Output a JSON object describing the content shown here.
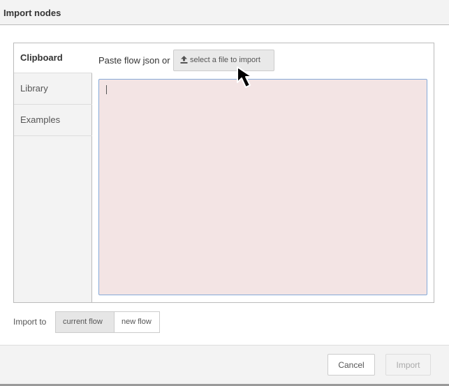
{
  "dialog": {
    "title": "Import nodes"
  },
  "tabs": [
    {
      "label": "Clipboard",
      "active": true
    },
    {
      "label": "Library",
      "active": false
    },
    {
      "label": "Examples",
      "active": false
    }
  ],
  "clipboard": {
    "paste_label": "Paste flow json or",
    "file_button_label": "select a file to import",
    "file_button_icon": "upload-icon",
    "editor_value": ""
  },
  "import_to": {
    "label": "Import to",
    "options": [
      "current flow",
      "new flow"
    ],
    "selected": "current flow"
  },
  "footer": {
    "cancel_label": "Cancel",
    "import_label": "Import",
    "import_enabled": false
  },
  "colors": {
    "editor_background": "#f3e4e4",
    "editor_border": "#85a9d8",
    "titlebar_background": "#f3f3f3"
  }
}
